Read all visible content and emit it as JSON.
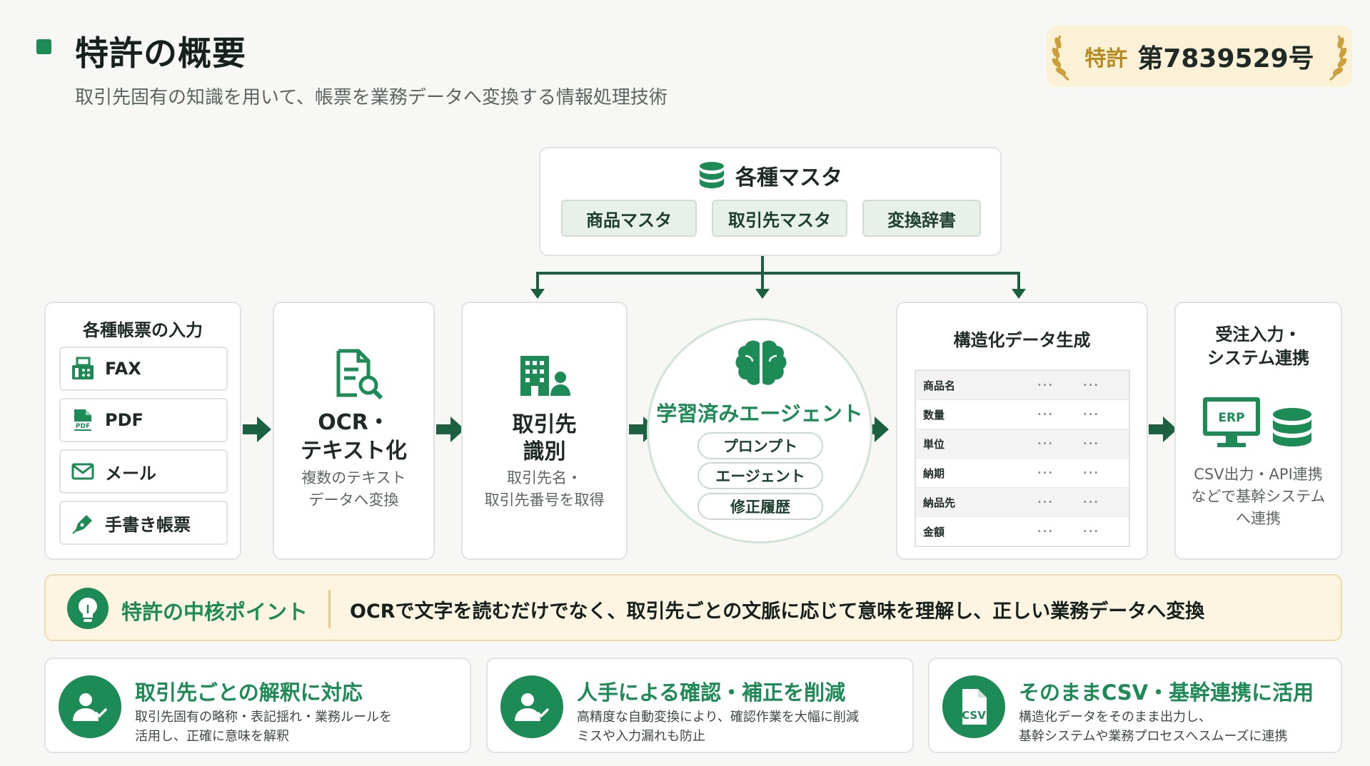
{
  "header": {
    "title": "特許の概要",
    "subtitle": "取引先固有の知識を用いて、帳票を業務データへ変換する情報処理技術",
    "patent_label": "特許",
    "patent_number": "第7839529号"
  },
  "master": {
    "title": "各種マスタ",
    "items": [
      "商品マスタ",
      "取引先マスタ",
      "変換辞書"
    ]
  },
  "inputs": {
    "title": "各種帳票の入力",
    "items": [
      "FAX",
      "PDF",
      "メール",
      "手書き帳票"
    ]
  },
  "ocr": {
    "title_line1": "OCR・",
    "title_line2": "テキスト化",
    "desc_line1": "複数のテキスト",
    "desc_line2": "データへ変換"
  },
  "client": {
    "title_line1": "取引先",
    "title_line2": "識別",
    "desc_line1": "取引先名・",
    "desc_line2": "取引先番号を取得"
  },
  "agent": {
    "title": "学習済みエージェント",
    "pills": [
      "プロンプト",
      "エージェント",
      "修正履歴"
    ]
  },
  "structured": {
    "title": "構造化データ生成",
    "rows": [
      "商品名",
      "数量",
      "単位",
      "納期",
      "納品先",
      "金額"
    ],
    "dots": "···"
  },
  "order": {
    "title_line1": "受注入力・",
    "title_line2": "システム連携",
    "erp_label": "ERP",
    "desc_line1": "CSV出力・API連携",
    "desc_line2": "などで基幹システム",
    "desc_line3": "へ連携"
  },
  "core": {
    "label": "特許の中核ポイント",
    "text": "OCRで文字を読むだけでなく、取引先ごとの文脈に応じて意味を理解し、正しい業務データへ変換"
  },
  "benefits": [
    {
      "title": "取引先ごとの解釈に対応",
      "desc1": "取引先固有の略称・表記揺れ・業務ルールを",
      "desc2": "活用し、正確に意味を解釈"
    },
    {
      "title": "人手による確認・補正を削減",
      "desc1": "高精度な自動変換により、確認作業を大幅に削減",
      "desc2": "ミスや入力漏れも防止"
    },
    {
      "title": "そのままCSV・基幹連携に活用",
      "desc1": "構造化データをそのまま出力し、",
      "desc2": "基幹システムや業務プロセスへスムーズに連携",
      "icon_text": "CSV"
    }
  ],
  "colors": {
    "accent": "#1d8b55",
    "dark_green": "#1b6040",
    "gold": "#b68a1e",
    "cream": "#fdf5e1"
  }
}
